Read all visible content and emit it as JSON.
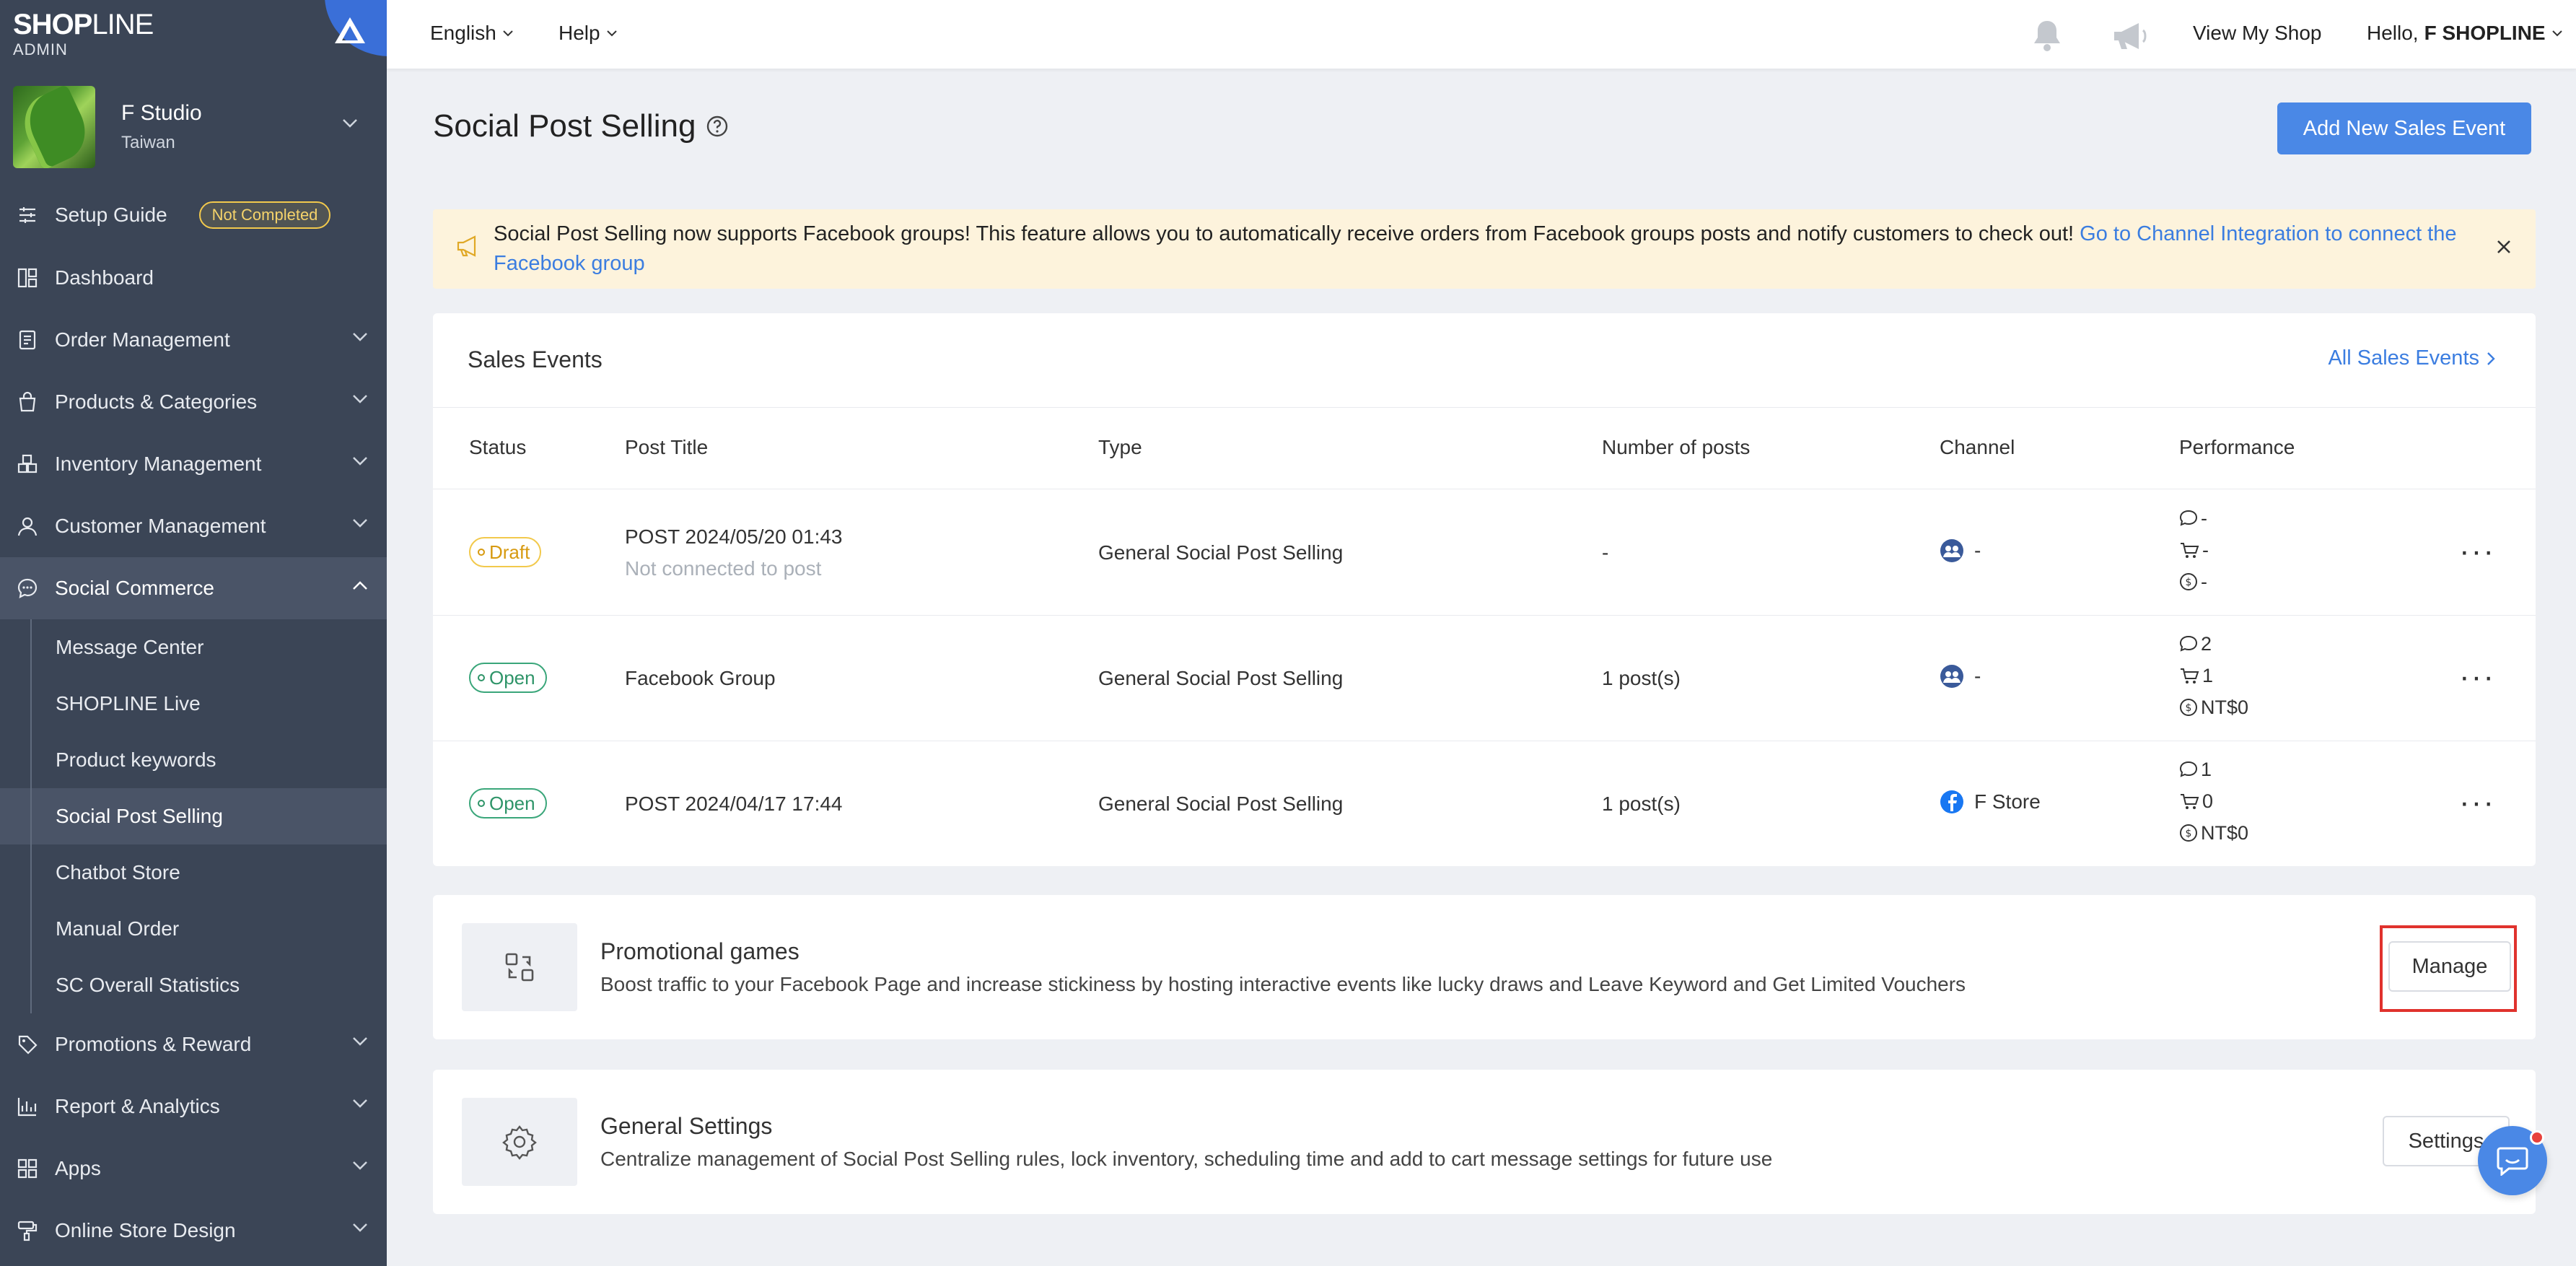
{
  "brand": {
    "name_bold": "SHOP",
    "name_light": "LINE",
    "sub": "ADMIN"
  },
  "store": {
    "name": "F Studio",
    "region": "Taiwan"
  },
  "sidebar": {
    "setup_guide": {
      "label": "Setup Guide",
      "badge": "Not Completed"
    },
    "items": [
      {
        "label": "Dashboard"
      },
      {
        "label": "Order Management"
      },
      {
        "label": "Products & Categories"
      },
      {
        "label": "Inventory Management"
      },
      {
        "label": "Customer Management"
      },
      {
        "label": "Social Commerce"
      }
    ],
    "social_sub": [
      {
        "label": "Message Center"
      },
      {
        "label": "SHOPLINE Live"
      },
      {
        "label": "Product keywords"
      },
      {
        "label": "Social Post Selling"
      },
      {
        "label": "Chatbot Store"
      },
      {
        "label": "Manual Order"
      },
      {
        "label": "SC Overall Statistics"
      }
    ],
    "bottom_items": [
      {
        "label": "Promotions & Reward"
      },
      {
        "label": "Report & Analytics"
      },
      {
        "label": "Apps"
      },
      {
        "label": "Online Store Design"
      }
    ]
  },
  "topbar": {
    "language": "English",
    "help": "Help",
    "view_shop": "View My Shop",
    "hello_prefix": "Hello,",
    "user": "F SHOPLINE"
  },
  "page": {
    "title": "Social Post Selling",
    "add_button": "Add New Sales Event"
  },
  "notice": {
    "text": "Social Post Selling now supports Facebook groups! This feature allows you to automatically receive orders from Facebook groups posts and notify customers to check out!",
    "link": "Go to Channel Integration to connect the Facebook group"
  },
  "sales_events": {
    "title": "Sales Events",
    "all_link": "All Sales Events",
    "columns": [
      "Status",
      "Post Title",
      "Type",
      "Number of posts",
      "Channel",
      "Performance"
    ],
    "rows": [
      {
        "status": "Draft",
        "title": "POST 2024/05/20 01:43",
        "subtitle": "Not connected to post",
        "type": "General Social Post Selling",
        "posts": "-",
        "channel": "-",
        "comments": "-",
        "carts": "-",
        "sales": "-"
      },
      {
        "status": "Open",
        "title": "Facebook Group",
        "subtitle": "",
        "type": "General Social Post Selling",
        "posts": "1 post(s)",
        "channel": "-",
        "comments": "2",
        "carts": "1",
        "sales": "NT$0"
      },
      {
        "status": "Open",
        "title": "POST 2024/04/17 17:44",
        "subtitle": "",
        "type": "General Social Post Selling",
        "posts": "1 post(s)",
        "channel": "F Store",
        "comments": "1",
        "carts": "0",
        "sales": "NT$0"
      }
    ]
  },
  "promo": {
    "title": "Promotional games",
    "desc": "Boost traffic to your Facebook Page and increase stickiness by hosting interactive events like lucky draws and Leave Keyword and Get Limited Vouchers",
    "button": "Manage"
  },
  "general": {
    "title": "General Settings",
    "desc": "Centralize management of Social Post Selling rules, lock inventory, scheduling time and add to cart message settings for future use",
    "button": "Settings"
  },
  "colors": {
    "sidebar": "#3b4556",
    "accent": "#4a88e6",
    "highlight": "#e0322d",
    "notice_bg": "#fdf3dc"
  }
}
